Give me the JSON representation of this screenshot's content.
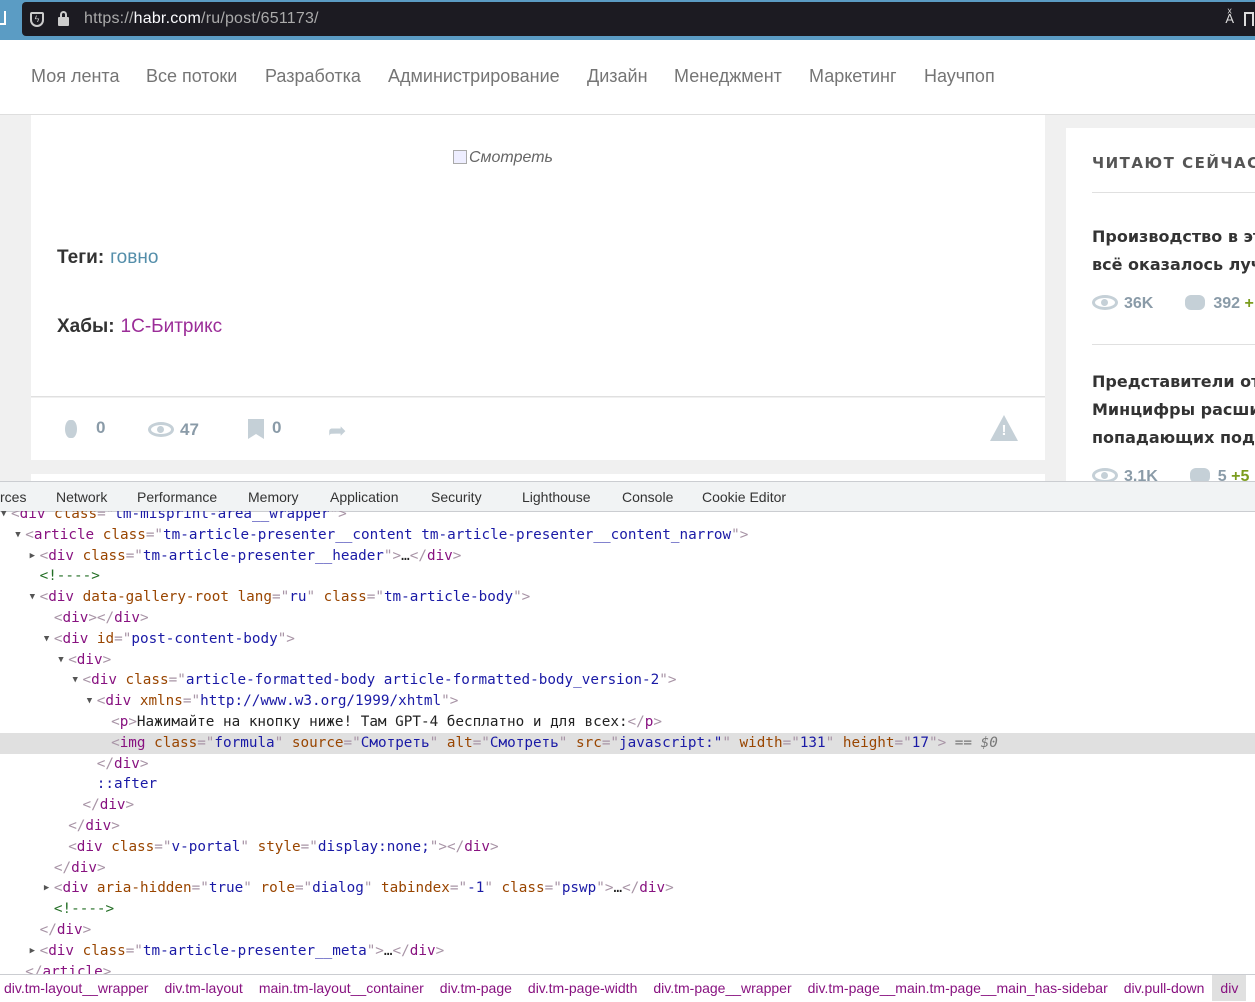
{
  "browser": {
    "url_scheme": "https://",
    "url_host": "habr.com",
    "url_path": "/ru/post/651173/"
  },
  "nav": [
    "Моя лента",
    "Все потоки",
    "Разработка",
    "Администрирование",
    "Дизайн",
    "Менеджмент",
    "Маркетинг",
    "Научпоп"
  ],
  "article": {
    "broken_image_alt": "Смотреть",
    "tags_label": "Теги:",
    "tag": "говно",
    "hubs_label": "Хабы:",
    "hub": "1С-Битрикс",
    "link_color": "#548eaa",
    "hub_color": "#9b2d98"
  },
  "stats": {
    "votes": "0",
    "views": "47",
    "bookmarks": "0"
  },
  "sidebar": {
    "heading": "ЧИТАЮТ СЕЙЧАС",
    "items": [
      {
        "title": [
          "Производство в это",
          "всё оказалось лучш"
        ],
        "views": "36K",
        "comments": "392",
        "new": "+"
      },
      {
        "title": [
          "Представители отр",
          "Минцифры расшир",
          "попадающих под л"
        ],
        "views": "3.1K",
        "comments": "5",
        "new": "+5"
      }
    ]
  },
  "devtools": {
    "tabs": [
      "rces",
      "Network",
      "Performance",
      "Memory",
      "Application",
      "Security",
      "Lighthouse",
      "Console",
      "Cookie Editor"
    ],
    "lines": [
      {
        "d": 0,
        "t": "open",
        "c": [
          [
            "pu",
            "<"
          ],
          [
            "tag",
            "div"
          ],
          [
            "an",
            " class"
          ],
          [
            "pu",
            "=\""
          ],
          [
            "av",
            "tm-misprint-area__wrapper"
          ],
          [
            "pu",
            "\">"
          ]
        ]
      },
      {
        "d": 1,
        "t": "open",
        "c": [
          [
            "pu",
            "<"
          ],
          [
            "tag",
            "article"
          ],
          [
            "an",
            " class"
          ],
          [
            "pu",
            "=\""
          ],
          [
            "av",
            "tm-article-presenter__content tm-article-presenter__content_narrow"
          ],
          [
            "pu",
            "\">"
          ]
        ]
      },
      {
        "d": 2,
        "t": "closed",
        "c": [
          [
            "pu",
            "<"
          ],
          [
            "tag",
            "div"
          ],
          [
            "an",
            " class"
          ],
          [
            "pu",
            "=\""
          ],
          [
            "av",
            "tm-article-presenter__header"
          ],
          [
            "pu",
            "\">"
          ],
          [
            "tx",
            "…"
          ],
          [
            "pu",
            "</"
          ],
          [
            "tag",
            "div"
          ],
          [
            "pu",
            ">"
          ]
        ]
      },
      {
        "d": 2,
        "c": [
          [
            "cm",
            "<!---->"
          ]
        ]
      },
      {
        "d": 2,
        "t": "open",
        "c": [
          [
            "pu",
            "<"
          ],
          [
            "tag",
            "div"
          ],
          [
            "an",
            " data-gallery-root lang"
          ],
          [
            "pu",
            "=\""
          ],
          [
            "av",
            "ru"
          ],
          [
            "pu",
            "\""
          ],
          [
            "an",
            " class"
          ],
          [
            "pu",
            "=\""
          ],
          [
            "av",
            "tm-article-body"
          ],
          [
            "pu",
            "\">"
          ]
        ]
      },
      {
        "d": 3,
        "c": [
          [
            "pu",
            "<"
          ],
          [
            "tag",
            "div"
          ],
          [
            "pu",
            "></"
          ],
          [
            "tag",
            "div"
          ],
          [
            "pu",
            ">"
          ]
        ]
      },
      {
        "d": 3,
        "t": "open",
        "c": [
          [
            "pu",
            "<"
          ],
          [
            "tag",
            "div"
          ],
          [
            "an",
            " id"
          ],
          [
            "pu",
            "=\""
          ],
          [
            "av",
            "post-content-body"
          ],
          [
            "pu",
            "\">"
          ]
        ]
      },
      {
        "d": 4,
        "t": "open",
        "c": [
          [
            "pu",
            "<"
          ],
          [
            "tag",
            "div"
          ],
          [
            "pu",
            ">"
          ]
        ]
      },
      {
        "d": 5,
        "t": "open",
        "c": [
          [
            "pu",
            "<"
          ],
          [
            "tag",
            "div"
          ],
          [
            "an",
            " class"
          ],
          [
            "pu",
            "=\""
          ],
          [
            "av",
            "article-formatted-body article-formatted-body_version-2"
          ],
          [
            "pu",
            "\">"
          ]
        ]
      },
      {
        "d": 6,
        "t": "open",
        "c": [
          [
            "pu",
            "<"
          ],
          [
            "tag",
            "div"
          ],
          [
            "an",
            " xmlns"
          ],
          [
            "pu",
            "=\""
          ],
          [
            "av",
            "http://www.w3.org/1999/xhtml"
          ],
          [
            "pu",
            "\">"
          ]
        ]
      },
      {
        "d": 7,
        "c": [
          [
            "pu",
            "<"
          ],
          [
            "tag",
            "p"
          ],
          [
            "pu",
            ">"
          ],
          [
            "tx",
            "Нажимайте на кнопку ниже! Там GPT-4 бесплатно и для всех:"
          ],
          [
            "pu",
            "</"
          ],
          [
            "tag",
            "p"
          ],
          [
            "pu",
            ">"
          ]
        ]
      },
      {
        "d": 7,
        "sel": true,
        "c": [
          [
            "pu",
            "<"
          ],
          [
            "tag",
            "img"
          ],
          [
            "an",
            " class"
          ],
          [
            "pu",
            "=\""
          ],
          [
            "av",
            "formula"
          ],
          [
            "pu",
            "\""
          ],
          [
            "an",
            " source"
          ],
          [
            "pu",
            "=\""
          ],
          [
            "av",
            "Смотреть"
          ],
          [
            "pu",
            "\""
          ],
          [
            "an",
            " alt"
          ],
          [
            "pu",
            "=\""
          ],
          [
            "av",
            "Смотреть"
          ],
          [
            "pu",
            "\""
          ],
          [
            "an",
            " src"
          ],
          [
            "pu",
            "=\""
          ],
          [
            "av",
            "javascript:\""
          ],
          [
            "pu",
            "\""
          ],
          [
            "an",
            " width"
          ],
          [
            "pu",
            "=\""
          ],
          [
            "av",
            "131"
          ],
          [
            "pu",
            "\""
          ],
          [
            "an",
            " height"
          ],
          [
            "pu",
            "=\""
          ],
          [
            "av",
            "17"
          ],
          [
            "pu",
            "\">"
          ],
          [
            "dl",
            " == $0"
          ]
        ]
      },
      {
        "d": 6,
        "c": [
          [
            "pu",
            "</"
          ],
          [
            "tag",
            "div"
          ],
          [
            "pu",
            ">"
          ]
        ]
      },
      {
        "d": 6,
        "c": [
          [
            "ps",
            "::after"
          ]
        ]
      },
      {
        "d": 5,
        "c": [
          [
            "pu",
            "</"
          ],
          [
            "tag",
            "div"
          ],
          [
            "pu",
            ">"
          ]
        ]
      },
      {
        "d": 4,
        "c": [
          [
            "pu",
            "</"
          ],
          [
            "tag",
            "div"
          ],
          [
            "pu",
            ">"
          ]
        ]
      },
      {
        "d": 4,
        "c": [
          [
            "pu",
            "<"
          ],
          [
            "tag",
            "div"
          ],
          [
            "an",
            " class"
          ],
          [
            "pu",
            "=\""
          ],
          [
            "av",
            "v-portal"
          ],
          [
            "pu",
            "\""
          ],
          [
            "an",
            " style"
          ],
          [
            "pu",
            "=\""
          ],
          [
            "av",
            "display:none;"
          ],
          [
            "pu",
            "\"></"
          ],
          [
            "tag",
            "div"
          ],
          [
            "pu",
            ">"
          ]
        ]
      },
      {
        "d": 3,
        "c": [
          [
            "pu",
            "</"
          ],
          [
            "tag",
            "div"
          ],
          [
            "pu",
            ">"
          ]
        ]
      },
      {
        "d": 3,
        "t": "closed",
        "c": [
          [
            "pu",
            "<"
          ],
          [
            "tag",
            "div"
          ],
          [
            "an",
            " aria-hidden"
          ],
          [
            "pu",
            "=\""
          ],
          [
            "av",
            "true"
          ],
          [
            "pu",
            "\""
          ],
          [
            "an",
            " role"
          ],
          [
            "pu",
            "=\""
          ],
          [
            "av",
            "dialog"
          ],
          [
            "pu",
            "\""
          ],
          [
            "an",
            " tabindex"
          ],
          [
            "pu",
            "=\""
          ],
          [
            "av",
            "-1"
          ],
          [
            "pu",
            "\""
          ],
          [
            "an",
            " class"
          ],
          [
            "pu",
            "=\""
          ],
          [
            "av",
            "pswp"
          ],
          [
            "pu",
            "\">"
          ],
          [
            "tx",
            "…"
          ],
          [
            "pu",
            "</"
          ],
          [
            "tag",
            "div"
          ],
          [
            "pu",
            ">"
          ]
        ]
      },
      {
        "d": 3,
        "c": [
          [
            "cm",
            "<!---->"
          ]
        ]
      },
      {
        "d": 2,
        "c": [
          [
            "pu",
            "</"
          ],
          [
            "tag",
            "div"
          ],
          [
            "pu",
            ">"
          ]
        ]
      },
      {
        "d": 2,
        "t": "closed",
        "c": [
          [
            "pu",
            "<"
          ],
          [
            "tag",
            "div"
          ],
          [
            "an",
            " class"
          ],
          [
            "pu",
            "=\""
          ],
          [
            "av",
            "tm-article-presenter__meta"
          ],
          [
            "pu",
            "\">"
          ],
          [
            "tx",
            "…"
          ],
          [
            "pu",
            "</"
          ],
          [
            "tag",
            "div"
          ],
          [
            "pu",
            ">"
          ]
        ]
      },
      {
        "d": 1,
        "c": [
          [
            "pu",
            "</"
          ],
          [
            "tag",
            "article"
          ],
          [
            "pu",
            ">"
          ]
        ]
      }
    ],
    "breadcrumbs": [
      "div.tm-layout__wrapper",
      "div.tm-layout",
      "main.tm-layout__container",
      "div.tm-page",
      "div.tm-page-width",
      "div.tm-page__wrapper",
      "div.tm-page__main.tm-page__main_has-sidebar",
      "div.pull-down",
      "div"
    ]
  }
}
